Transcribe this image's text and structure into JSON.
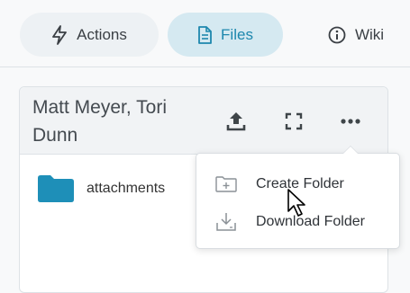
{
  "tabs": [
    {
      "label": "Actions",
      "icon": "lightning-icon"
    },
    {
      "label": "Files",
      "icon": "file-icon",
      "active": true
    },
    {
      "label": "Wiki",
      "icon": "info-icon"
    }
  ],
  "panel": {
    "title": "Matt Meyer, Tori Dunn",
    "buttons": [
      "upload-icon",
      "expand-icon",
      "more-icon"
    ]
  },
  "files": [
    {
      "name": "attachments",
      "type": "folder",
      "icon": "folder-icon"
    }
  ],
  "menu": {
    "items": [
      {
        "label": "Create Folder",
        "icon": "folder-add-icon"
      },
      {
        "label": "Download Folder",
        "icon": "download-icon"
      }
    ]
  },
  "colors": {
    "accent": "#1d87ad",
    "active_tab_bg": "#d5e9f1",
    "folder": "#1e8fb8"
  }
}
